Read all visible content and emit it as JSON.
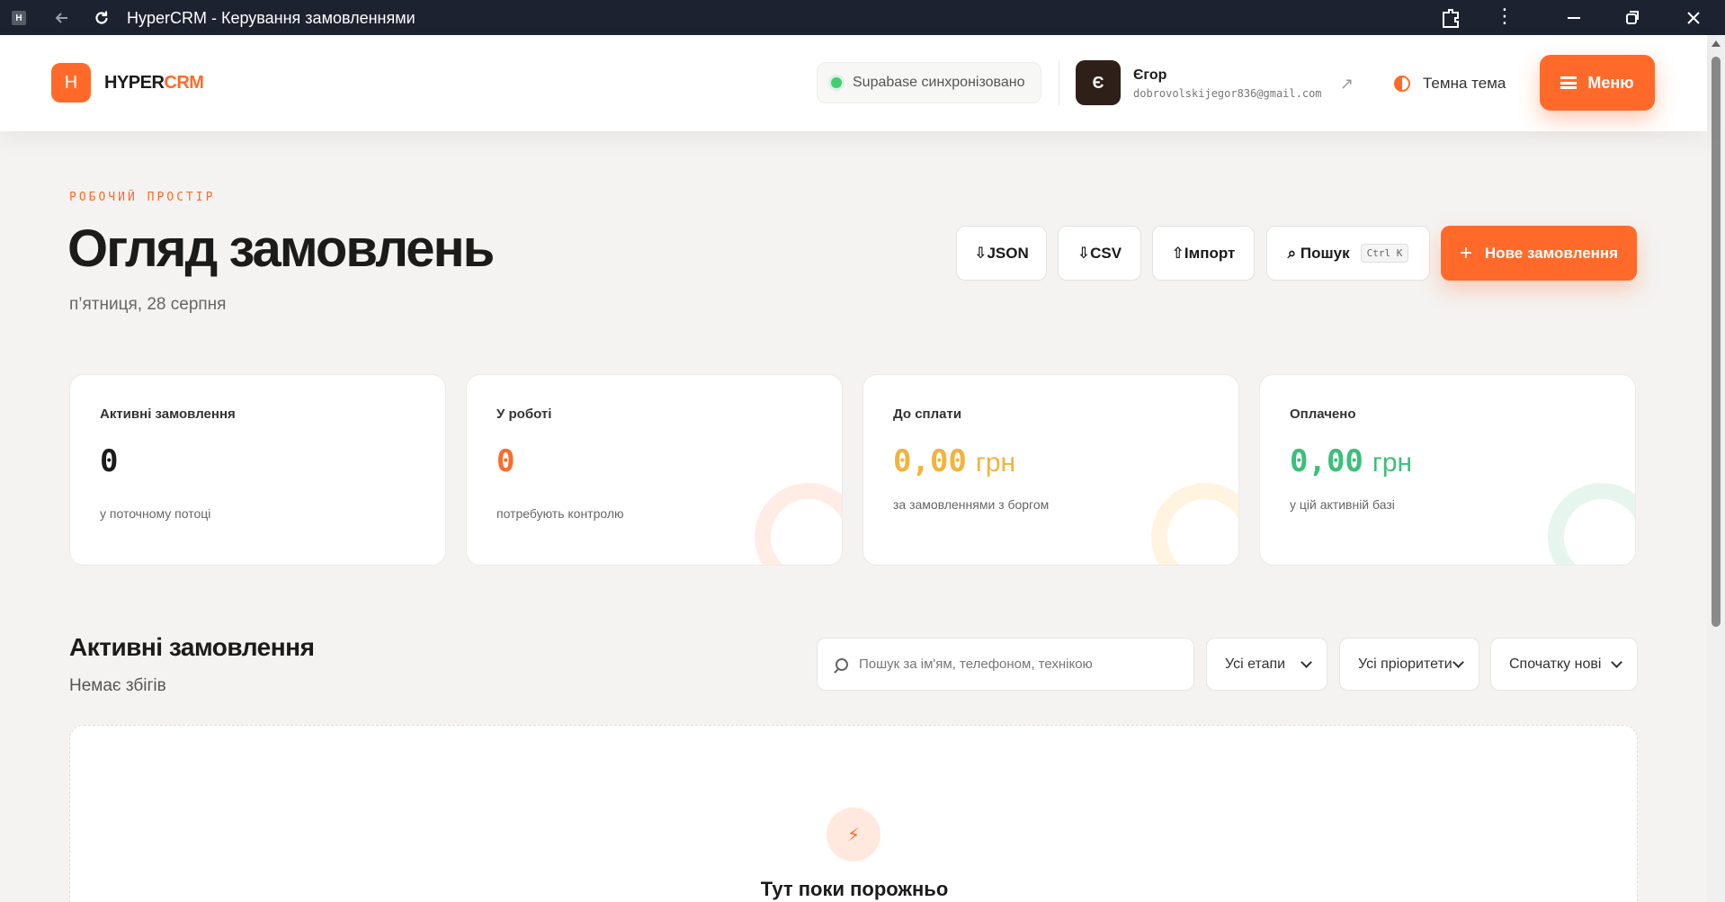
{
  "browser": {
    "tab_title": "HyperCRM - Керування замовленнями",
    "favicon_letter": "H"
  },
  "header": {
    "logo_letter": "H",
    "logo_text_a": "HYPER",
    "logo_text_b": "CRM",
    "sync_status": "Supabase синхронізовано",
    "user": {
      "avatar_letter": "Є",
      "name": "Єгор",
      "email": "dobrovolskijegor836@gmail.com"
    },
    "theme_label": "Темна тема",
    "menu_label": "Меню"
  },
  "hero": {
    "kicker": "РОБОЧИЙ ПРОСТІР",
    "title": "Огляд замовлень",
    "date": "п’ятниця, 28 серпня",
    "actions": {
      "json": "⇩JSON",
      "csv": "⇩CSV",
      "import": "⇧Імпорт",
      "search": "⌕ Пошук",
      "search_shortcut": "Ctrl K",
      "new_order": "Нове замовлення"
    }
  },
  "stats": [
    {
      "label": "Активні замовлення",
      "value": "0",
      "unit": "",
      "sub": "у поточному потоці",
      "color": "#1b1b1b"
    },
    {
      "label": "У роботі",
      "value": "0",
      "unit": "",
      "sub": "потребують контролю",
      "color": "#ff6a2a"
    },
    {
      "label": "До сплати",
      "value": "0,00",
      "unit": "грн",
      "sub": "за замовленнями з боргом",
      "color": "#f2b33d"
    },
    {
      "label": "Оплачено",
      "value": "0,00",
      "unit": "грн",
      "sub": "у цій активній базі",
      "color": "#3cbf79"
    }
  ],
  "orders": {
    "title": "Активні замовлення",
    "subtitle": "Немає збігів",
    "search_placeholder": "Пошук за ім'ям, телефоном, технікою",
    "filter_stage": "Усі етапи",
    "filter_priority": "Усі пріоритети",
    "sort": "Спочатку нові",
    "empty_icon": "⚡",
    "empty_text": "Тут поки порожньо"
  },
  "colors": {
    "accent": "#ff6a2a",
    "titlebar": "#1c2230",
    "background": "#f4f3f1",
    "sync_dot": "#3ecf6f"
  }
}
